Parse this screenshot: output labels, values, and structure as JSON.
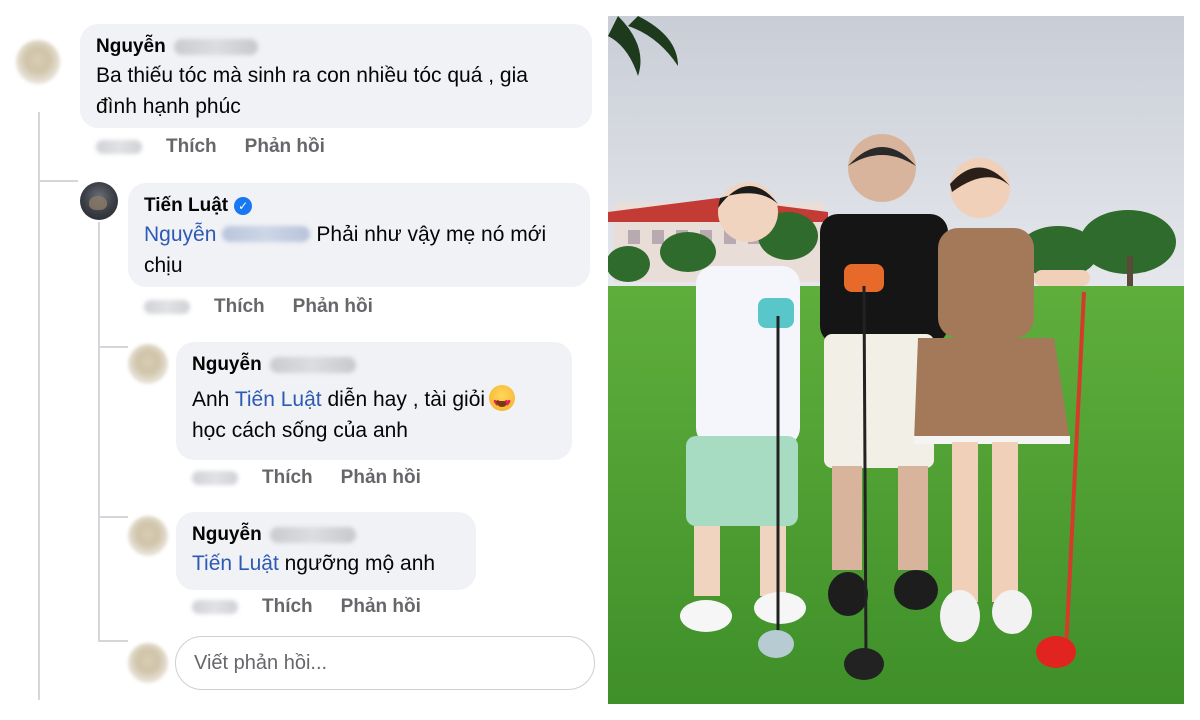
{
  "comments": [
    {
      "author": "Nguyễn",
      "text": "Ba thiếu tóc mà sinh ra con nhiều tóc quá , gia đình hạnh phúc",
      "text_line1": "Ba thiếu tóc mà sinh ra con nhiều tóc quá , gia",
      "text_line2": "đình hạnh phúc",
      "actions": [
        "Thích",
        "Phản hồi"
      ]
    },
    {
      "author": "Tiến Luật",
      "verified": true,
      "mention": "Nguyễn",
      "text_line1": "Phải như vậy mẹ nó mới",
      "text_line2": "chịu",
      "actions": [
        "Thích",
        "Phản hồi"
      ]
    },
    {
      "author": "Nguyễn",
      "prefix": "Anh",
      "mention": "Tiến Luật",
      "text_line1": "diễn hay , tài giỏi",
      "emoji": "heart-eyes-emoji",
      "text_line2": "học cách sống của anh",
      "actions": [
        "Thích",
        "Phản hồi"
      ]
    },
    {
      "author": "Nguyễn",
      "mention": "Tiến Luật",
      "text_line1": "ngưỡng mộ anh",
      "actions": [
        "Thích",
        "Phản hồi"
      ]
    }
  ],
  "reply_box": {
    "placeholder": "Viết phản hồi..."
  },
  "colors": {
    "bubble": "#f0f2f5",
    "mention": "#2d5ab4",
    "meta": "#65676b",
    "verified": "#1877f2"
  }
}
